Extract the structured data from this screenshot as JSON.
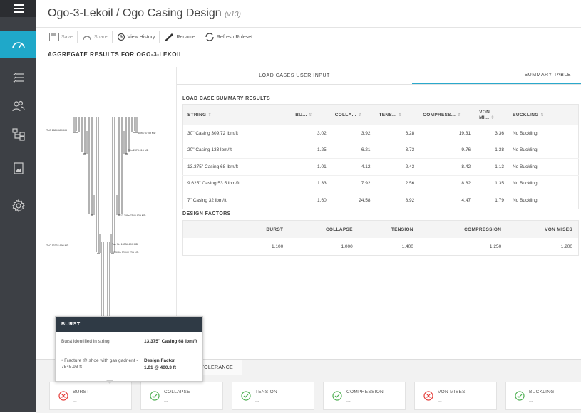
{
  "app": {
    "title": "Ogo-3-Lekoil / Ogo Casing Design",
    "version": "(v13)"
  },
  "sidebar": {
    "items": [
      {
        "icon": "menu-icon"
      },
      {
        "icon": "gauge-icon"
      },
      {
        "icon": "checklist-icon"
      },
      {
        "icon": "users-icon"
      },
      {
        "icon": "hierarchy-icon"
      },
      {
        "icon": "image-icon"
      },
      {
        "icon": "gear-icon"
      }
    ],
    "active_color": "#1fa8c9"
  },
  "toolbar": {
    "save": "Save",
    "share": "Share",
    "view_history": "View History",
    "rename": "Rename",
    "refresh": "Refresh Ruleset"
  },
  "aggregate_title": "AGGREGATE RESULTS FOR OGO-3-LEKOIL",
  "tabs": {
    "input": "LOAD CASES USER INPUT",
    "summary": "SUMMARY TABLE"
  },
  "summary": {
    "title": "LOAD CASE SUMMARY RESULTS",
    "headers": [
      "STRING",
      "BU...",
      "COLLA...",
      "TENS...",
      "COMPRESS...",
      "VON MI...",
      "BUCKLING"
    ],
    "rows": [
      [
        "30\" Casing 309.72 lbm/ft",
        "3.02",
        "3.92",
        "6.28",
        "19.31",
        "3.36",
        "No Buckling"
      ],
      [
        "20\" Casing 133 lbm/ft",
        "1.25",
        "6.21",
        "3.73",
        "9.76",
        "1.38",
        "No Buckling"
      ],
      [
        "13.375\" Casing 68 lbm/ft",
        "1.01",
        "4.12",
        "2.43",
        "8.42",
        "1.13",
        "No Buckling"
      ],
      [
        "9.625\" Casing 53.5 lbm/ft",
        "1.33",
        "7.92",
        "2.56",
        "8.82",
        "1.35",
        "No Buckling"
      ],
      [
        "7\" Casing 32 lbm/ft",
        "1.60",
        "24.58",
        "8.92",
        "4.47",
        "1.79",
        "No Buckling"
      ]
    ]
  },
  "design_factors": {
    "title": "DESIGN FACTORS",
    "headers": [
      "BURST",
      "COLLAPSE",
      "TENSION",
      "COMPRESSION",
      "VON MISES"
    ],
    "values": [
      "1.100",
      "1.000",
      "1.400",
      "1.250",
      "1.200"
    ]
  },
  "schematic": {
    "labels": [
      "TvC 1884.48ft MD",
      "30in 787.4ft MD",
      "20in 2878.01ft MD",
      "13 3/8in 7545.93ft MD",
      "TvC 13334.69ft MD",
      "Top 7in 13334.69ft MD",
      "9 5/8in 13442.73ft MD"
    ]
  },
  "kick_tolerance": "KICK TOLERANCE",
  "cards": [
    {
      "label": "BURST",
      "status": "fail",
      "value": "..."
    },
    {
      "label": "COLLAPSE",
      "status": "pass",
      "value": "..."
    },
    {
      "label": "TENSION",
      "status": "pass",
      "value": "..."
    },
    {
      "label": "COMPRESSION",
      "status": "pass",
      "value": "..."
    },
    {
      "label": "VON MISES",
      "status": "fail",
      "value": "..."
    },
    {
      "label": "BUCKLING",
      "status": "pass",
      "value": "..."
    }
  ],
  "colors": {
    "pass": "#4caf50",
    "fail": "#e53935",
    "accent": "#2aa9cc"
  },
  "tooltip": {
    "title": "BURST",
    "left1": "Burst identified in string",
    "right1": "13.375\" Casing 68 lbm/ft",
    "left2": "• Fracture @ shoe with gas gadrient - 7545.93 ft",
    "right2_label": "Design Factor",
    "right2_value": "1.01 @ 400.3 ft"
  }
}
